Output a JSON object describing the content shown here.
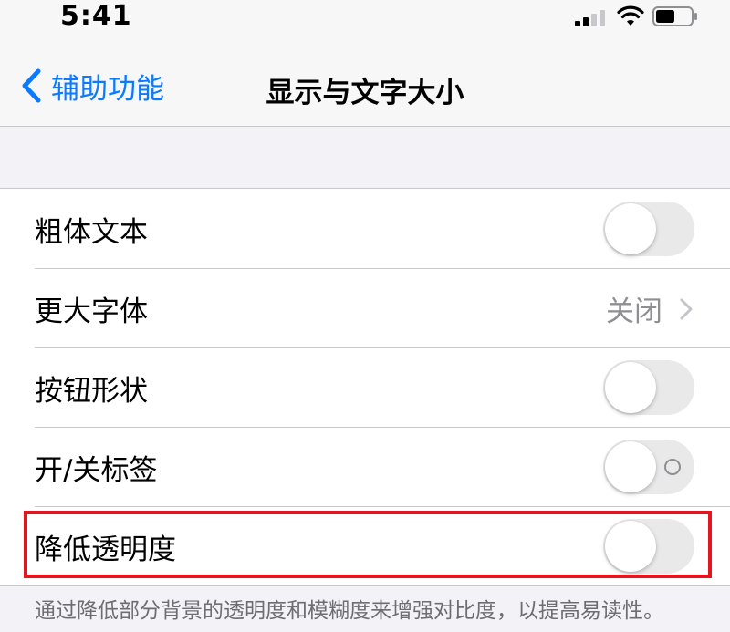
{
  "status_bar": {
    "time": "5:41",
    "signal_icon": "cellular-signal-icon",
    "wifi_icon": "wifi-icon",
    "battery_icon": "battery-icon",
    "signal_bars_active": 2,
    "signal_bars_total": 4,
    "battery_level": 0.5
  },
  "nav": {
    "back_label": "辅助功能",
    "back_icon": "chevron-left-icon",
    "title": "显示与文字大小"
  },
  "settings": {
    "bold_text": {
      "label": "粗体文本",
      "on": false
    },
    "larger_text": {
      "label": "更大字体",
      "value": "关闭",
      "icon": "chevron-right-icon"
    },
    "button_shapes": {
      "label": "按钮形状",
      "on": false
    },
    "on_off_labels": {
      "label": "开/关标签",
      "on": false
    },
    "reduce_transparency": {
      "label": "降低透明度",
      "on": false
    }
  },
  "footer": {
    "text": "通过降低部分背景的透明度和模糊度来增强对比度，以提高易读性。"
  },
  "colors": {
    "accent": "#0a7aff",
    "highlight": "#e5141f",
    "toggle_off": "#e9e9ea",
    "secondary_text": "#8e8e93",
    "background": "#f2f2f7"
  }
}
